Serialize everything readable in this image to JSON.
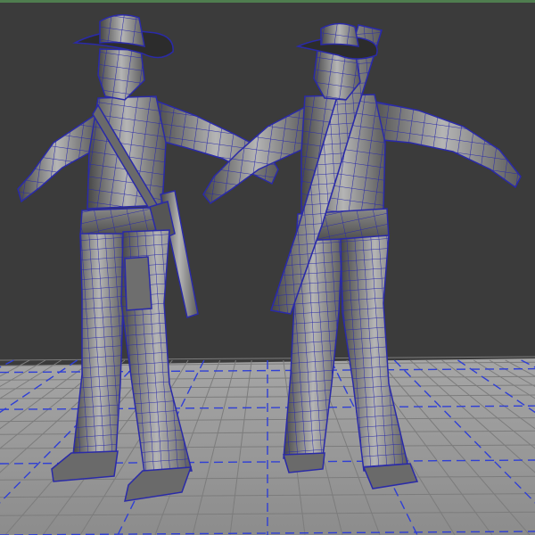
{
  "viewport": {
    "background_color": "#3b3b3b",
    "border_color": "#4f7d4f",
    "grid_minor_color": "#8f8f8f",
    "grid_major_color": "#2f3fd6",
    "floor_color": "#9a9a9a",
    "wireframe_color": "#2a2aa8",
    "mesh_shade_dark": "#3a3a3a",
    "mesh_shade_light": "#b8b8b8"
  },
  "scene": {
    "models": [
      {
        "id": "character-front",
        "name": "cowboy-character-front-view"
      },
      {
        "id": "character-back",
        "name": "cowboy-character-back-view"
      }
    ]
  }
}
